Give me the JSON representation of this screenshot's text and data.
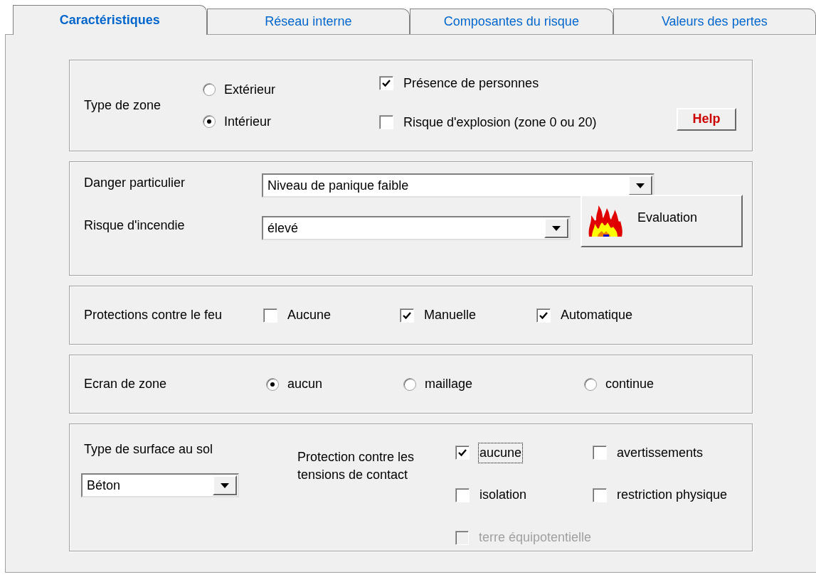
{
  "tabs": [
    {
      "label": "Caractéristiques",
      "selected": true
    },
    {
      "label": "Réseau interne",
      "selected": false
    },
    {
      "label": "Composantes du risque",
      "selected": false
    },
    {
      "label": "Valeurs des pertes",
      "selected": false
    }
  ],
  "zone_type": {
    "label": "Type de zone",
    "radios": [
      {
        "label": "Extérieur",
        "selected": false
      },
      {
        "label": "Intérieur",
        "selected": true
      }
    ],
    "checkboxes": [
      {
        "label": "Présence de personnes",
        "checked": true
      },
      {
        "label": "Risque d'explosion (zone 0 ou 20)",
        "checked": false
      }
    ],
    "help_button": "Help"
  },
  "hazard": {
    "special_danger": {
      "label": "Danger particulier",
      "value": "Niveau de panique faible"
    },
    "fire_risk": {
      "label": "Risque d'incendie",
      "value": "élevé"
    },
    "evaluation_button": "Evaluation"
  },
  "fire_protection": {
    "label": "Protections contre le feu",
    "options": [
      {
        "label": "Aucune",
        "checked": false
      },
      {
        "label": "Manuelle",
        "checked": true
      },
      {
        "label": "Automatique",
        "checked": true
      }
    ]
  },
  "zone_screen": {
    "label": "Ecran de zone",
    "options": [
      {
        "label": "aucun",
        "selected": true
      },
      {
        "label": "maillage",
        "selected": false
      },
      {
        "label": "continue",
        "selected": false
      }
    ]
  },
  "floor_surface": {
    "label": "Type de surface au sol",
    "value": "Béton"
  },
  "contact_protection": {
    "label": "Protection contre les tensions de contact",
    "options": [
      {
        "label": "aucune",
        "checked": true,
        "disabled": false,
        "focused": true
      },
      {
        "label": "avertissements",
        "checked": false,
        "disabled": false,
        "focused": false
      },
      {
        "label": "isolation",
        "checked": false,
        "disabled": false,
        "focused": false
      },
      {
        "label": "restriction physique",
        "checked": false,
        "disabled": false,
        "focused": false
      },
      {
        "label": "terre équipotentielle",
        "checked": false,
        "disabled": true,
        "focused": false
      }
    ]
  }
}
